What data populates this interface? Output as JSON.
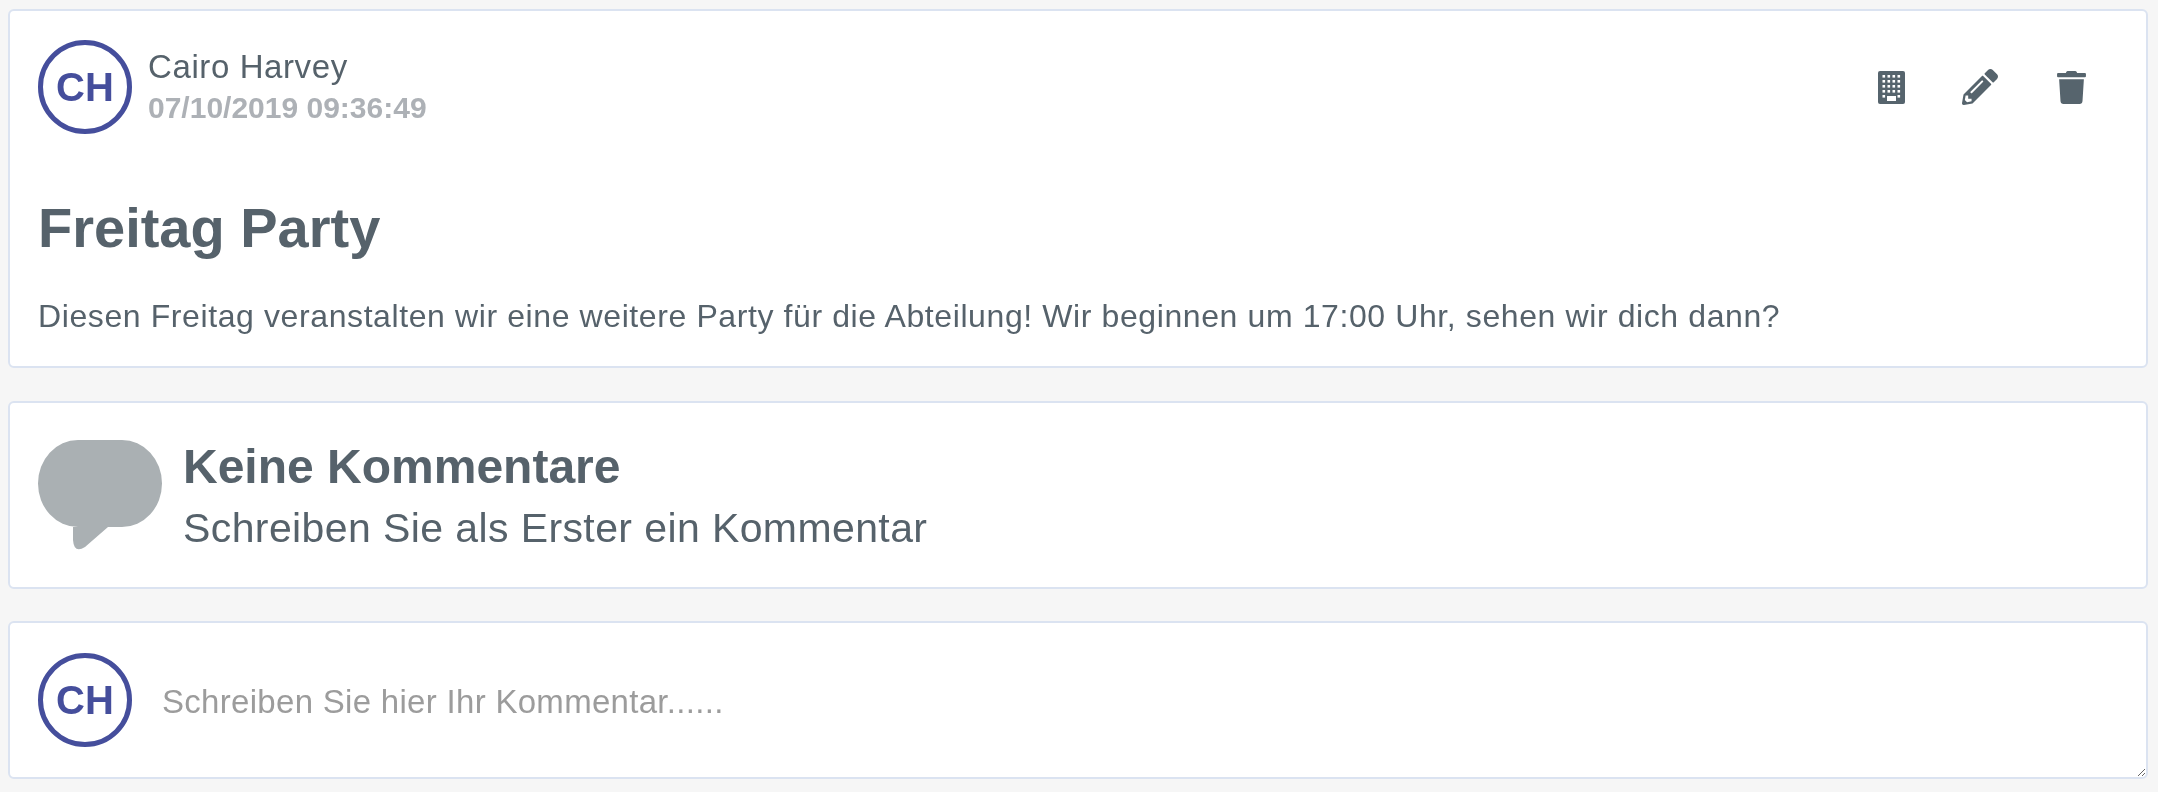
{
  "post": {
    "author": {
      "initials": "CH",
      "name": "Cairo Harvey",
      "timestamp": "07/10/2019 09:36:49"
    },
    "actions": [
      {
        "kind": "building"
      },
      {
        "kind": "edit"
      },
      {
        "kind": "delete"
      }
    ],
    "title": "Freitag Party",
    "body": "Diesen Freitag veranstalten wir eine weitere Party für die Abteilung! Wir beginnen um 17:00 Uhr, sehen wir dich dann?"
  },
  "comments": {
    "title": "Keine Kommentare",
    "subtitle": "Schreiben Sie als Erster ein Kommentar"
  },
  "composer": {
    "initials": "CH",
    "placeholder": "Schreiben Sie hier Ihr Kommentar......"
  }
}
